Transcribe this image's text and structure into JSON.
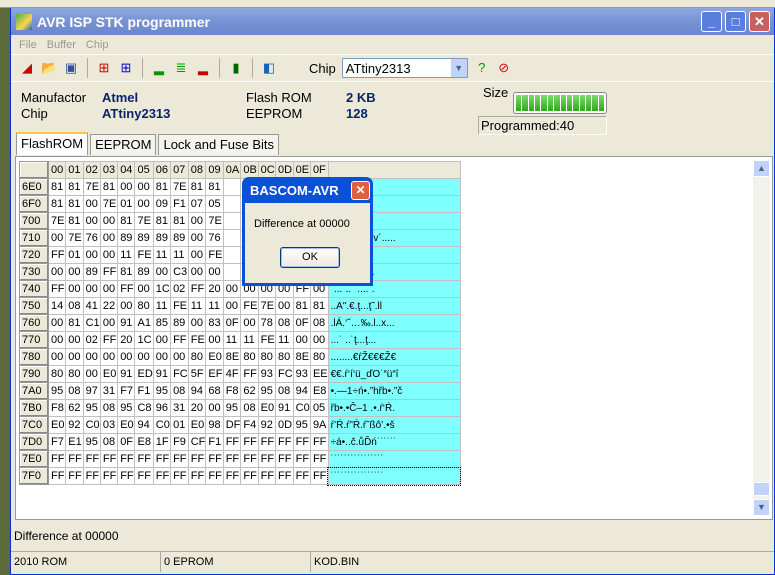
{
  "window": {
    "title": "AVR ISP STK programmer",
    "app_icon_text": "AVR"
  },
  "menu": [
    "File",
    "Buffer",
    "Chip"
  ],
  "toolbar": {
    "chip_label": "Chip",
    "chip_value": "ATtiny2313"
  },
  "info": {
    "manufactor_label": "Manufactor",
    "manufactor_value": "Atmel",
    "chip_label": "Chip",
    "chip_value": "ATtiny2313",
    "flash_label": "Flash ROM",
    "flash_value": "2 KB",
    "eeprom_label": "EEPROM",
    "eeprom_value": "128",
    "size_label": "Size",
    "size_fill_percent": 100,
    "programmed": "Programmed:40"
  },
  "tabs": [
    "FlashROM",
    "EEPROM",
    "Lock and Fuse Bits"
  ],
  "grid": {
    "columns": [
      "00",
      "01",
      "02",
      "03",
      "04",
      "05",
      "06",
      "07",
      "08",
      "09",
      "0A",
      "0B",
      "0C",
      "0D",
      "0E",
      "0F"
    ],
    "rows": [
      {
        "addr": "6E0",
        "bytes": [
          "81",
          "81",
          "7E",
          "81",
          "00",
          "00",
          "81",
          "7E",
          "81",
          "81",
          "",
          "",
          "",
          "",
          "",
          ""
        ],
        "ascii": "l˜ll.˜.$l˜"
      },
      {
        "addr": "6F0",
        "bytes": [
          "81",
          "81",
          "00",
          "7E",
          "01",
          "00",
          "09",
          "F1",
          "07",
          "05",
          "",
          "",
          "",
          "",
          "",
          ""
        ],
        "ascii": ".ń....˜.ll"
      },
      {
        "addr": "700",
        "bytes": [
          "7E",
          "81",
          "00",
          "00",
          "81",
          "7E",
          "81",
          "81",
          "00",
          "7E",
          "",
          "",
          "",
          "",
          "",
          ""
        ],
        "ascii": "˜ll.˜.$l˜ll"
      },
      {
        "addr": "710",
        "bytes": [
          "00",
          "7E",
          "76",
          "00",
          "89",
          "89",
          "89",
          "89",
          "00",
          "76",
          "",
          "",
          "",
          "",
          "",
          ""
        ],
        "ascii": "‰‰‰‰.v´....."
      },
      {
        "addr": "720",
        "bytes": [
          "FF",
          "01",
          "00",
          "00",
          "11",
          "FE",
          "11",
          "11",
          "00",
          "FE",
          "",
          "",
          "",
          "",
          "",
          ""
        ],
        "ascii": "...ţ´.ll<B"
      },
      {
        "addr": "730",
        "bytes": [
          "00",
          "00",
          "89",
          "FF",
          "81",
          "89",
          "00",
          "C3",
          "00",
          "00",
          "",
          "",
          "",
          "",
          "",
          ""
        ],
        "ascii": "l‰.Ă........"
      },
      {
        "addr": "740",
        "bytes": [
          "FF",
          "00",
          "00",
          "00",
          "FF",
          "00",
          "1C",
          "02",
          "FF",
          "20",
          "00",
          "00",
          "00",
          "00",
          "FF",
          "00"
        ],
        "ascii": "˙...˙..˙ ....˙."
      },
      {
        "addr": "750",
        "bytes": [
          "14",
          "08",
          "41",
          "22",
          "00",
          "80",
          "11",
          "FE",
          "11",
          "11",
          "00",
          "FE",
          "7E",
          "00",
          "81",
          "81"
        ],
        "ascii": "..A\".€.ţ...ţ˜.ll"
      },
      {
        "addr": "760",
        "bytes": [
          "00",
          "81",
          "C1",
          "00",
          "91",
          "A1",
          "85",
          "89",
          "00",
          "83",
          "0F",
          "00",
          "78",
          "08",
          "0F",
          "08"
        ],
        "ascii": ".lÁ.‘ˇ…‰.l..x..."
      },
      {
        "addr": "770",
        "bytes": [
          "00",
          "00",
          "02",
          "FF",
          "20",
          "1C",
          "00",
          "FF",
          "FE",
          "00",
          "11",
          "11",
          "FE",
          "11",
          "00",
          "00"
        ],
        "ascii": "...˙ ..˙ţ...ţ..."
      },
      {
        "addr": "780",
        "bytes": [
          "00",
          "00",
          "00",
          "00",
          "00",
          "00",
          "00",
          "00",
          "80",
          "E0",
          "8E",
          "80",
          "80",
          "80",
          "8E",
          "80"
        ],
        "ascii": "........€ŕŽ€€€Ž€"
      },
      {
        "addr": "790",
        "bytes": [
          "80",
          "80",
          "00",
          "E0",
          "91",
          "ED",
          "91",
          "FC",
          "5F",
          "EF",
          "4F",
          "FF",
          "93",
          "FC",
          "93",
          "EE"
        ],
        "ascii": "€€.ŕ‘í‘ü_ďO˙“ü“î"
      },
      {
        "addr": "7A0",
        "bytes": [
          "95",
          "08",
          "97",
          "31",
          "F7",
          "F1",
          "95",
          "08",
          "94",
          "68",
          "F8",
          "62",
          "95",
          "08",
          "94",
          "E8"
        ],
        "ascii": "•.—1÷ń•.”hřb•.”č"
      },
      {
        "addr": "7B0",
        "bytes": [
          "F8",
          "62",
          "95",
          "08",
          "95",
          "C8",
          "96",
          "31",
          "20",
          "00",
          "95",
          "08",
          "E0",
          "91",
          "C0",
          "05"
        ],
        "ascii": "řb•.•Č–1 .•.ŕ‘Ŕ."
      },
      {
        "addr": "7C0",
        "bytes": [
          "E0",
          "92",
          "C0",
          "03",
          "E0",
          "94",
          "C0",
          "01",
          "E0",
          "98",
          "DF",
          "F4",
          "92",
          "0D",
          "95",
          "9A"
        ],
        "ascii": "ŕ’Ŕ.ŕ”Ŕ.ŕ˜ßô’.•š"
      },
      {
        "addr": "7D0",
        "bytes": [
          "F7",
          "E1",
          "95",
          "08",
          "0F",
          "E8",
          "1F",
          "F9",
          "CF",
          "F1",
          "FF",
          "FF",
          "FF",
          "FF",
          "FF",
          "FF"
        ],
        "ascii": "÷á•..č.ůĎń˙˙˙˙˙˙"
      },
      {
        "addr": "7E0",
        "bytes": [
          "FF",
          "FF",
          "FF",
          "FF",
          "FF",
          "FF",
          "FF",
          "FF",
          "FF",
          "FF",
          "FF",
          "FF",
          "FF",
          "FF",
          "FF",
          "FF"
        ],
        "ascii": "˙˙˙˙˙˙˙˙˙˙˙˙˙˙˙˙"
      },
      {
        "addr": "7F0",
        "bytes": [
          "FF",
          "FF",
          "FF",
          "FF",
          "FF",
          "FF",
          "FF",
          "FF",
          "FF",
          "FF",
          "FF",
          "FF",
          "FF",
          "FF",
          "FF",
          "FF"
        ],
        "ascii": "˙˙˙˙˙˙˙˙˙˙˙˙˙˙˙˙"
      }
    ]
  },
  "status_message": "Difference at 00000",
  "statusbar": [
    "2010 ROM",
    "0 EPROM",
    "KOD.BIN"
  ],
  "dialog": {
    "title": "BASCOM-AVR",
    "message": "Difference at 00000",
    "ok": "OK"
  }
}
